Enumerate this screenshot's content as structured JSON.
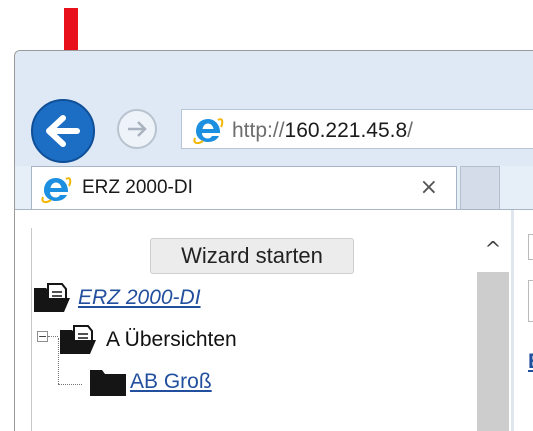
{
  "browser": {
    "address_url_prefix": "http://",
    "address_url_host": "160.221.45.8",
    "address_url_suffix": "/",
    "tab_title": "ERZ 2000-DI",
    "tab_close": "×"
  },
  "left_frame": {
    "wizard_button": "Wizard starten",
    "tree": [
      {
        "label": "ERZ 2000-DI"
      },
      {
        "label": "A Übersichten"
      },
      {
        "label": "AB Groß"
      }
    ],
    "scroll_up": "^"
  },
  "right_frame": {
    "link_partial": "E"
  },
  "colors": {
    "back_button": "#1c6ec4",
    "link": "#23509e",
    "annotation_arrow": "#e8111b"
  },
  "icons": [
    "back-arrow-icon",
    "forward-arrow-icon",
    "ie-logo-icon",
    "folder-open-icon",
    "folder-icon",
    "red-annotation-arrow"
  ]
}
